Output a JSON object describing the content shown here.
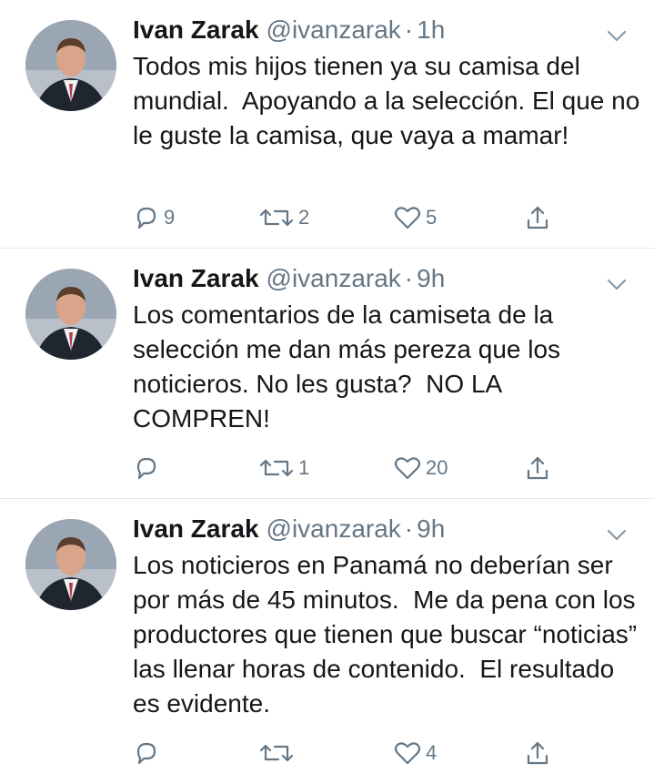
{
  "tweets": [
    {
      "author_name": "Ivan Zarak",
      "handle": "@ivanzarak",
      "separator": "·",
      "time": "1h",
      "text": "Todos mis hijos tienen ya su camisa del mundial.  Apoyando a la selección. El que no le guste la camisa, que vaya a mamar!",
      "replies": "9",
      "retweets": "2",
      "likes": "5"
    },
    {
      "author_name": "Ivan Zarak",
      "handle": "@ivanzarak",
      "separator": "·",
      "time": "9h",
      "text": "Los comentarios de la camiseta de la selección me dan más pereza que los noticieros. No les gusta?  NO LA COMPREN!",
      "replies": "",
      "retweets": "1",
      "likes": "20"
    },
    {
      "author_name": "Ivan Zarak",
      "handle": "@ivanzarak",
      "separator": "·",
      "time": "9h",
      "text": "Los noticieros en Panamá no deberían ser por más de 45 minutos.  Me da pena con los productores que tienen que buscar “noticias” las llenar horas de contenido.  El resultado es evidente.",
      "replies": "",
      "retweets": "",
      "likes": "4"
    }
  ],
  "icons": {
    "reply": "reply-icon",
    "retweet": "retweet-icon",
    "like": "heart-icon",
    "share": "share-icon",
    "more": "chevron-down-icon"
  },
  "colors": {
    "text": "#14171a",
    "secondary": "#657786",
    "divider": "#e1e8ed"
  }
}
